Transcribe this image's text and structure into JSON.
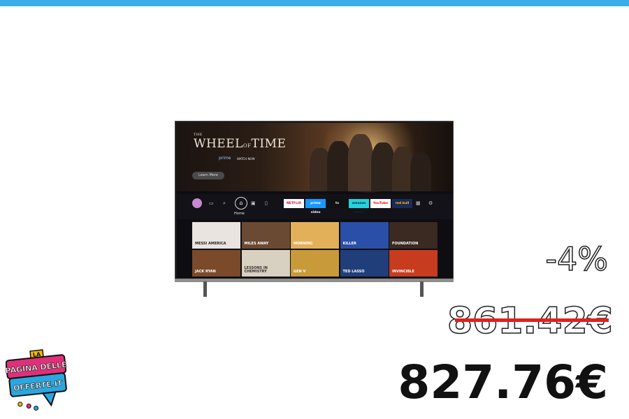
{
  "top_bar_color": "#3aaee8",
  "tv": {
    "hero_title_pre": "THE",
    "hero_title_main": "WHEEL",
    "hero_title_of": "OF",
    "hero_title_end": "TIME",
    "hero_prime": "prime",
    "hero_watch": "WATCH NOW",
    "learn_more": "Learn More",
    "home_label": "Home",
    "apps": [
      {
        "label": "NETFLIX",
        "bg": "#ffffff",
        "fg": "#e50914"
      },
      {
        "label": "prime video",
        "bg": "#1a98ff",
        "fg": "#ffffff"
      },
      {
        "label": "tv",
        "bg": "#111111",
        "fg": "#ffffff"
      },
      {
        "label": "amazon music",
        "bg": "#25d1da",
        "fg": "#0f2a3a"
      },
      {
        "label": "YouTube",
        "bg": "#ffffff",
        "fg": "#ff0000"
      },
      {
        "label": "red bull",
        "bg": "#1d2a57",
        "fg": "#ffcc00"
      }
    ],
    "tiles": [
      {
        "title": "MESSI AMERICA",
        "bg": "#e9e4df",
        "fg": "#222222"
      },
      {
        "title": "MILES AWAY",
        "bg": "#6a4a32",
        "fg": "#ffffff"
      },
      {
        "title": "MORNING",
        "bg": "#e3b05a",
        "fg": "#ffffff"
      },
      {
        "title": "KILLER",
        "bg": "#2a4fa8",
        "fg": "#ffffff"
      },
      {
        "title": "FOUNDATION",
        "bg": "#3b2a22",
        "fg": "#ffffff"
      },
      {
        "title": "JACK RYAN",
        "bg": "#7a4a2a",
        "fg": "#ffffff"
      },
      {
        "title": "LESSONS IN CHEMISTRY",
        "bg": "#d8d0c0",
        "fg": "#333333"
      },
      {
        "title": "GEN V",
        "bg": "#c99a3a",
        "fg": "#ffffff"
      },
      {
        "title": "TED LASSO",
        "bg": "#1f3e7a",
        "fg": "#ffffff"
      },
      {
        "title": "INVINCIBLE",
        "bg": "#c73b1e",
        "fg": "#ffffff"
      }
    ]
  },
  "price": {
    "discount": "-4%",
    "old_price": "861.42€",
    "new_price": "827.76€",
    "strike_color": "#e02020"
  },
  "logo": {
    "line1": "LA",
    "line2": "PAGINA DELLE",
    "line3": "OFFERTE.IT"
  }
}
